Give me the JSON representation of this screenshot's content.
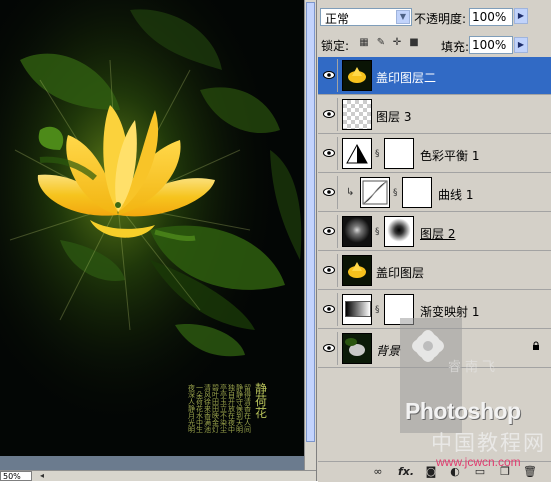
{
  "canvas": {
    "zoom": "50%",
    "poem_title": "静荷花",
    "poem_columns": [
      "夜深人静月光明",
      "一朵荷花水中生",
      "清风徐来香满池",
      "碧叶田田映金灯",
      "亭亭玉立不染尘",
      "独自开放在夜中",
      "静静守候到天明",
      "留得清香在人间"
    ]
  },
  "layers_panel": {
    "blend_mode": "正常",
    "opacity_label": "不透明度:",
    "opacity_value": "100%",
    "lock_label": "锁定:",
    "fill_label": "填充:",
    "fill_value": "100%",
    "layers": [
      {
        "name": "盖印图层二",
        "selected": true,
        "thumb": "lotus",
        "mask": false,
        "italic": false,
        "clipped": false,
        "locked": false
      },
      {
        "name": "图层 3",
        "selected": false,
        "thumb": "transparent",
        "mask": false,
        "italic": false,
        "clipped": false,
        "locked": false
      },
      {
        "name": "色彩平衡 1",
        "selected": false,
        "thumb": "color-balance",
        "mask": true,
        "italic": false,
        "clipped": false,
        "locked": false
      },
      {
        "name": "曲线 1",
        "selected": false,
        "thumb": "curves",
        "mask": true,
        "italic": false,
        "clipped": true,
        "locked": false
      },
      {
        "name": "图层 2",
        "selected": false,
        "thumb": "glow",
        "mask": true,
        "italic": false,
        "clipped": false,
        "locked": false
      },
      {
        "name": "盖印图层",
        "selected": false,
        "thumb": "lotus",
        "mask": false,
        "italic": false,
        "clipped": false,
        "locked": false
      },
      {
        "name": "渐变映射 1",
        "selected": false,
        "thumb": "gradient-map",
        "mask": true,
        "italic": false,
        "clipped": false,
        "locked": false
      },
      {
        "name": "背景",
        "selected": false,
        "thumb": "background",
        "mask": false,
        "italic": true,
        "clipped": false,
        "locked": true
      }
    ],
    "bottom_icons": [
      "link-icon",
      "fx-icon",
      "mask-icon",
      "adjustment-icon",
      "folder-icon",
      "new-layer-icon",
      "trash-icon"
    ]
  },
  "watermark": {
    "name": "睿南飞",
    "brand": "Photoshop",
    "site_cn": "中国教程网",
    "url": "www.jcwcn.com"
  },
  "colors": {
    "selection": "#316ac5",
    "panel_bg": "#d4d0c8",
    "lotus_yellow": "#f7c521",
    "leaf_green": "#3b7a14"
  }
}
